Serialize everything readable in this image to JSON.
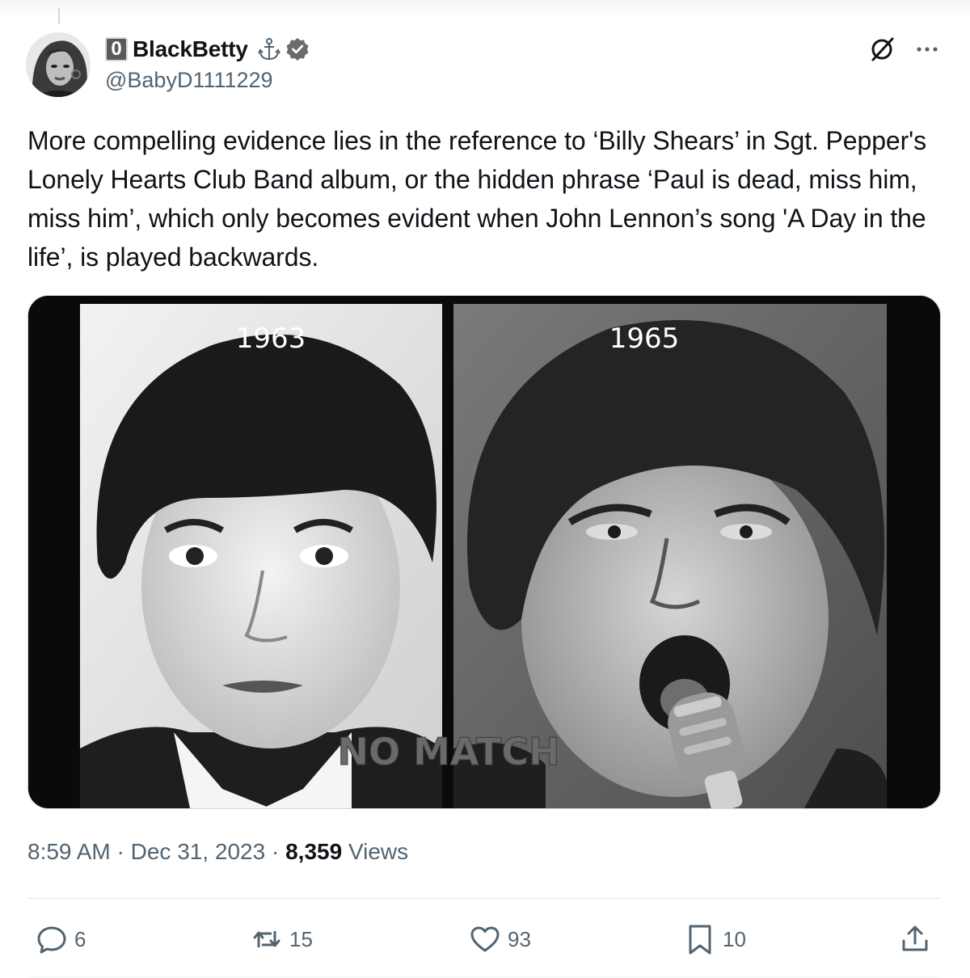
{
  "post": {
    "badge": "0",
    "display_name": "BlackBetty",
    "handle": "@BabyD1111229",
    "icons": [
      "anchor-icon",
      "verified-icon",
      "grok-icon",
      "more-icon"
    ],
    "text": "More compelling evidence lies in the reference to ‘Billy Shears’ in Sgt. Pepper's Lonely Hearts Club Band album, or the hidden phrase ‘Paul is dead, miss him, miss him’, which only becomes evident when John Lennon’s song 'A Day in the life’, is played backwards.",
    "image": {
      "left_label": "1963",
      "right_label": "1965",
      "overlay_text": "NO MATCH"
    },
    "time": "8:59 AM",
    "separator": "·",
    "date": "Dec 31, 2023",
    "views_count": "8,359",
    "views_label": "Views"
  },
  "actions": {
    "reply_count": "6",
    "repost_count": "15",
    "like_count": "93",
    "bookmark_count": "10"
  },
  "colors": {
    "text": "#0f1419",
    "secondary": "#536471",
    "divider": "#e3e8eb"
  }
}
